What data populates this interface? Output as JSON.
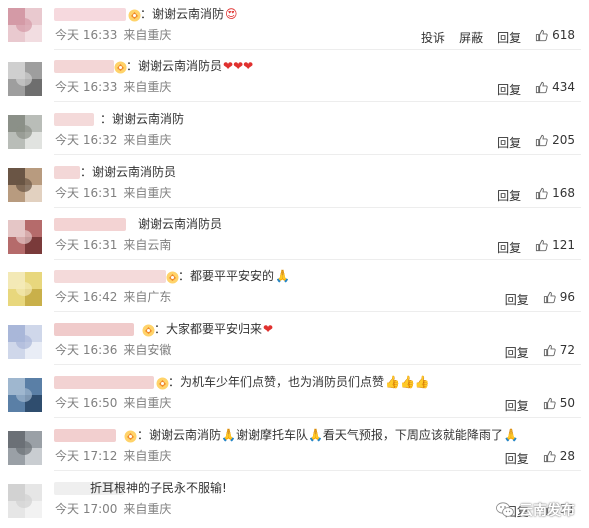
{
  "comments": [
    {
      "text": "：谢谢云南消防",
      "emoji": "😍",
      "time": "今天 16:33",
      "location": "来自重庆",
      "actions": [
        "投诉",
        "屏蔽",
        "回复"
      ],
      "likes": "618",
      "avatar_colors": [
        "#e9c9cf",
        "#d49aa6",
        "#f2dde1"
      ],
      "name_color": "#f6d9de"
    },
    {
      "text": "：谢谢云南消防员",
      "emoji": "❤❤❤",
      "time": "今天 16:33",
      "location": "来自重庆",
      "actions": [
        "回复"
      ],
      "likes": "434",
      "avatar_colors": [
        "#9e9e9e",
        "#cfcfcf",
        "#6e6e6e"
      ],
      "name_color": "#f3d6d6"
    },
    {
      "text": "：谢谢云南消防",
      "emoji": "",
      "time": "今天 16:32",
      "location": "来自重庆",
      "actions": [
        "回复"
      ],
      "likes": "205",
      "avatar_colors": [
        "#b9bdb8",
        "#8b9088",
        "#e1e3e0"
      ],
      "name_color": "#f4dada"
    },
    {
      "text": "：谢谢云南消防员",
      "emoji": "",
      "time": "今天 16:31",
      "location": "来自重庆",
      "actions": [
        "回复"
      ],
      "likes": "168",
      "avatar_colors": [
        "#b89b7f",
        "#6a5545",
        "#e2d1c0"
      ],
      "name_color": "#f3d7d7"
    },
    {
      "text": "谢谢云南消防员",
      "emoji": "",
      "time": "今天 16:31",
      "location": "来自云南",
      "actions": [
        "回复"
      ],
      "likes": "121",
      "avatar_colors": [
        "#b56b6b",
        "#e5c6c6",
        "#7a3a3a"
      ],
      "name_color": "#f3d3d3"
    },
    {
      "text": "：都要平平安安的",
      "emoji": "🙏",
      "time": "今天 16:42",
      "location": "来自广东",
      "actions": [
        "回复"
      ],
      "likes": "96",
      "avatar_colors": [
        "#e8d77d",
        "#f3e9b6",
        "#c9b04a"
      ],
      "name_color": "#f4dada"
    },
    {
      "text": "：大家都要平安归来",
      "emoji": "❤",
      "time": "今天 16:36",
      "location": "来自安徽",
      "actions": [
        "回复"
      ],
      "likes": "72",
      "avatar_colors": [
        "#cfd7ea",
        "#a9b7d9",
        "#e9edf6"
      ],
      "name_color": "#f0cbcb"
    },
    {
      "text": "：为机车少年们点赞，也为消防员们点赞",
      "emoji": "👍👍👍",
      "time": "今天 16:50",
      "location": "来自重庆",
      "actions": [
        "回复"
      ],
      "likes": "50",
      "avatar_colors": [
        "#5a7fa6",
        "#9fb7cf",
        "#2f4d6e"
      ],
      "name_color": "#f2d2d2"
    },
    {
      "text": "：谢谢云南消防🙏谢谢摩托车队🙏看天气预报，下周应该就能降雨了",
      "emoji": "🙏",
      "time": "今天 17:12",
      "location": "来自重庆",
      "actions": [
        "回复"
      ],
      "likes": "28",
      "avatar_colors": [
        "#9aa0a6",
        "#6b7076",
        "#c9cdd1"
      ],
      "name_color": "#f2cfcf"
    },
    {
      "text": "折耳根神的子民永不服输!",
      "emoji": "",
      "time": "今天 17:00",
      "location": "来自重庆",
      "actions": [
        "回复"
      ],
      "likes": "31",
      "avatar_colors": [
        "#e6e6e6",
        "#d2d2d2",
        "#f2f2f2"
      ],
      "name_color": "#efefef"
    }
  ],
  "watermark": {
    "label": "云南发布"
  },
  "colors": {
    "meta": "#808080",
    "text": "#333333",
    "separator": "#ededed"
  }
}
